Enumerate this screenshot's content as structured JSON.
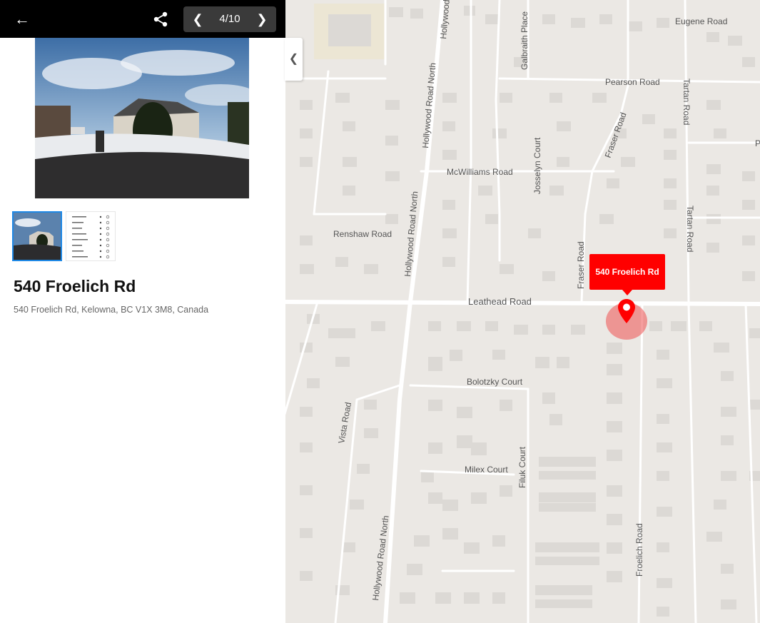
{
  "topbar": {
    "back_icon": "arrow-left-icon",
    "share_icon": "share-icon",
    "pager": {
      "counter": "4/10",
      "prev_icon": "chevron-left-icon",
      "next_icon": "chevron-right-icon"
    }
  },
  "photo": {
    "description_icon": "street-photo"
  },
  "thumbnails": [
    {
      "name": "photo-thumbnail",
      "selected": true
    },
    {
      "name": "document-thumbnail",
      "selected": false
    }
  ],
  "place": {
    "title": "540 Froelich Rd",
    "address": "540 Froelich Rd, Kelowna, BC V1X 3M8, Canada"
  },
  "map": {
    "marker_label": "540 Froelich Rd",
    "marker_color": "#ff0000",
    "collapse_icon": "chevron-left-icon",
    "road_labels": {
      "eugene": "Eugene Road",
      "pearson": "Pearson Road",
      "tartan1": "Tartan Road",
      "tartan2": "Tartan Road",
      "galbraith": "Galbraith Place",
      "hollywood_top": "Hollywood",
      "hollywood1": "Hollywood Road North",
      "hollywood2": "Hollywood Road North",
      "hollywood3": "Hollywood Road North",
      "fraser1": "Fraser Road",
      "fraser2": "Fraser Road",
      "mcwilliams": "McWilliams Road",
      "josselyn": "Josselyn Court",
      "renshaw": "Renshaw Road",
      "leathead": "Leathead Road",
      "bolotzky": "Bolotzky Court",
      "vista": "Vista Road",
      "milex": "Milex Court",
      "filuk": "Filuk Court",
      "froelich": "Froelich Road",
      "p_edge": "P"
    }
  }
}
